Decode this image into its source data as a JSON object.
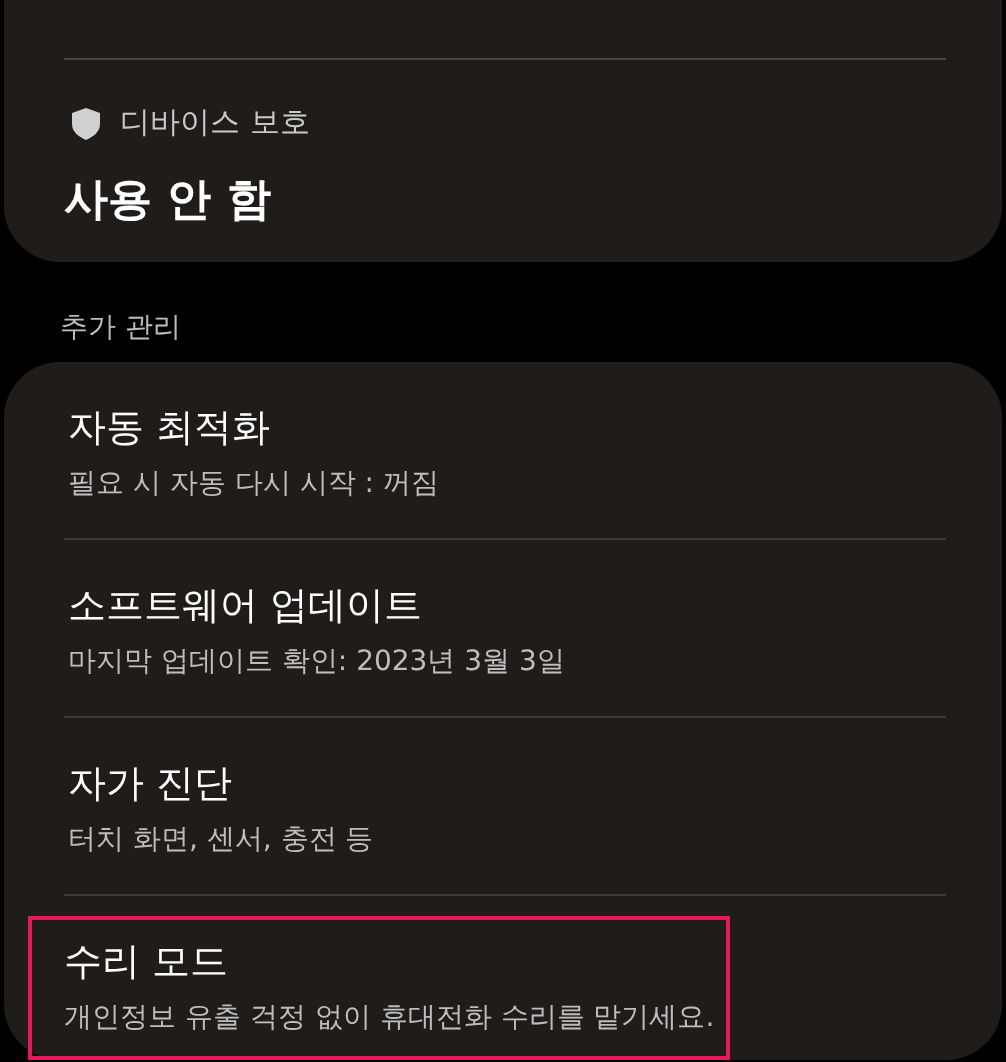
{
  "device_protection": {
    "label": "디바이스 보호",
    "value": "사용 안 함"
  },
  "section": {
    "title": "추가 관리"
  },
  "items": [
    {
      "title": "자동 최적화",
      "subtitle": "필요 시 자동 다시 시작 : 꺼짐",
      "highlighted": false
    },
    {
      "title": "소프트웨어 업데이트",
      "subtitle": "마지막 업데이트 확인: 2023년 3월 3일",
      "highlighted": false
    },
    {
      "title": "자가 진단",
      "subtitle": "터치 화면, 센서, 충전 등",
      "highlighted": false
    },
    {
      "title": "수리 모드",
      "subtitle": "개인정보 유출 걱정 없이 휴대전화 수리를 맡기세요.",
      "highlighted": true
    }
  ]
}
